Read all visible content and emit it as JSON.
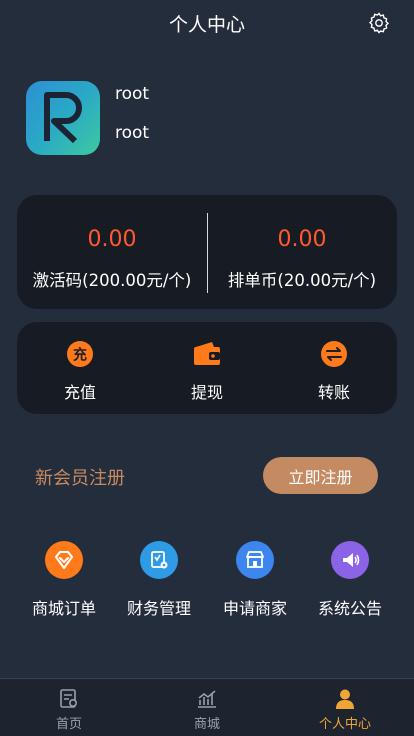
{
  "header": {
    "title": "个人中心",
    "settings_icon": "gear-icon"
  },
  "profile": {
    "username": "root",
    "user_id": "root",
    "avatar_icon": "letter-r-logo"
  },
  "balances": [
    {
      "value": "0.00",
      "label": "激活码(200.00元/个)"
    },
    {
      "value": "0.00",
      "label": "排单币(20.00元/个)"
    }
  ],
  "actions": [
    {
      "label": "充值",
      "icon": "recharge-icon"
    },
    {
      "label": "提现",
      "icon": "wallet-icon"
    },
    {
      "label": "转账",
      "icon": "transfer-icon"
    }
  ],
  "register": {
    "text": "新会员注册",
    "button": "立即注册"
  },
  "grid": [
    {
      "label": "商城订单",
      "icon": "diamond-icon",
      "color": "#ff7a1a"
    },
    {
      "label": "财务管理",
      "icon": "finance-icon",
      "color": "#2f9be6"
    },
    {
      "label": "申请商家",
      "icon": "shop-icon",
      "color": "#3d86f0"
    },
    {
      "label": "系统公告",
      "icon": "megaphone-icon",
      "color": "#8a63e6"
    }
  ],
  "tabbar": [
    {
      "label": "首页",
      "icon": "home-doc-icon",
      "active": false
    },
    {
      "label": "商城",
      "icon": "chart-icon",
      "active": false
    },
    {
      "label": "个人中心",
      "icon": "person-icon",
      "active": true
    }
  ],
  "colors": {
    "accent": "#ff5a2e",
    "register": "#c48a62",
    "active_tab": "#f0a535",
    "background": "#242d3b",
    "card": "#171b23"
  }
}
